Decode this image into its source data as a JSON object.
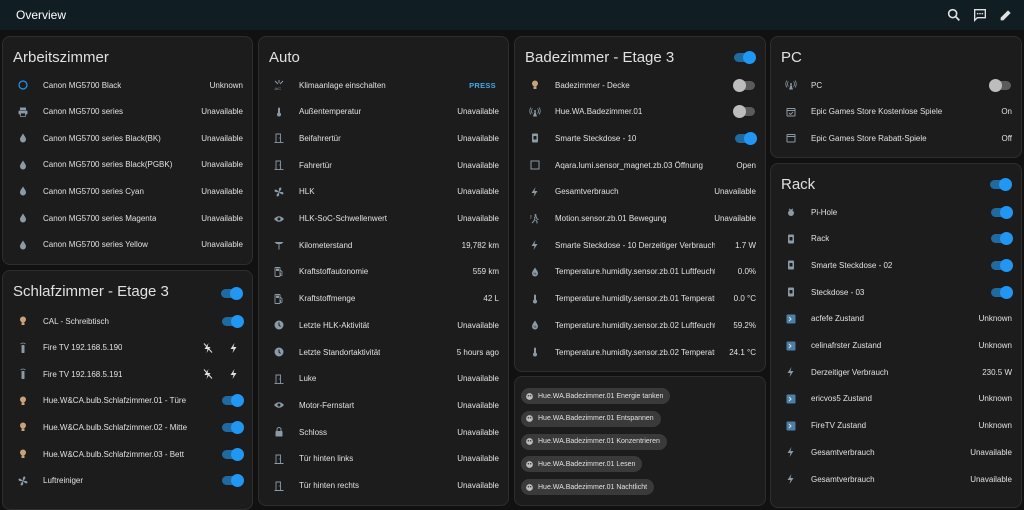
{
  "header": {
    "title": "Overview",
    "icons": [
      "search-icon",
      "chat-icon",
      "pencil-icon"
    ]
  },
  "colors": {
    "accent": "#2196f3",
    "background": "#111111",
    "card": "#1c1c1c",
    "topbar": "#101e24",
    "icon_gray": "#8a9aa6",
    "bulb": "#c8a27a"
  },
  "cards": {
    "arbeitszimmer": {
      "title": "Arbeitszimmer",
      "rows": [
        {
          "name": "Canon MG5700 Black",
          "state": "Unknown",
          "icon": "circle-outline-icon"
        },
        {
          "name": "Canon MG5700 series",
          "state": "Unavailable",
          "icon": "printer-icon"
        },
        {
          "name": "Canon MG5700 series Black(BK)",
          "state": "Unavailable",
          "icon": "water-drop-icon"
        },
        {
          "name": "Canon MG5700 series Black(PGBK)",
          "state": "Unavailable",
          "icon": "water-drop-icon"
        },
        {
          "name": "Canon MG5700 series Cyan",
          "state": "Unavailable",
          "icon": "water-drop-icon"
        },
        {
          "name": "Canon MG5700 series Magenta",
          "state": "Unavailable",
          "icon": "water-drop-icon"
        },
        {
          "name": "Canon MG5700 series Yellow",
          "state": "Unavailable",
          "icon": "water-drop-icon"
        }
      ]
    },
    "schlafzimmer": {
      "title": "Schlafzimmer - Etage 3",
      "header_toggle": "on",
      "rows": [
        {
          "name": "CAL - Schreibtisch",
          "toggle": "on",
          "icon": "bulb-icon"
        },
        {
          "name": "Fire TV 192.168.5.190",
          "buttons": [
            "flash-off-icon",
            "flash-icon"
          ],
          "icon": "remote-icon"
        },
        {
          "name": "Fire TV 192.168.5.191",
          "buttons": [
            "flash-off-icon",
            "flash-icon"
          ],
          "icon": "remote-icon"
        },
        {
          "name": "Hue.W&CA.bulb.Schlafzimmer.01 - Türe",
          "toggle": "on",
          "icon": "bulb-icon"
        },
        {
          "name": "Hue.W&CA.bulb.Schlafzimmer.02 - Mitte",
          "toggle": "on",
          "icon": "bulb-icon"
        },
        {
          "name": "Hue.W&CA.bulb.Schlafzimmer.03 - Bett",
          "toggle": "on",
          "icon": "bulb-icon"
        },
        {
          "name": "Luftreiniger",
          "toggle": "on",
          "icon": "fan-icon"
        }
      ]
    },
    "auto": {
      "title": "Auto",
      "rows": [
        {
          "name": "Klimaanlage einschalten",
          "press": "PRESS",
          "icon": "ac-icon"
        },
        {
          "name": "Außentemperatur",
          "state": "Unavailable",
          "icon": "thermometer-icon"
        },
        {
          "name": "Beifahrertür",
          "state": "Unavailable",
          "icon": "door-icon"
        },
        {
          "name": "Fahrertür",
          "state": "Unavailable",
          "icon": "door-icon"
        },
        {
          "name": "HLK",
          "state": "Unavailable",
          "icon": "fan-icon"
        },
        {
          "name": "HLK-SoC-Schwellenwert",
          "state": "Unavailable",
          "icon": "eye-icon"
        },
        {
          "name": "Kilometerstand",
          "state": "19,782 km",
          "icon": "road-icon"
        },
        {
          "name": "Kraftstoffautonomie",
          "state": "559 km",
          "icon": "fuel-icon"
        },
        {
          "name": "Kraftstoffmenge",
          "state": "42 L",
          "icon": "fuel-icon"
        },
        {
          "name": "Letzte HLK-Aktivität",
          "state": "Unavailable",
          "icon": "clock-icon"
        },
        {
          "name": "Letzte Standortaktivität",
          "state": "5 hours ago",
          "icon": "clock-icon"
        },
        {
          "name": "Luke",
          "state": "Unavailable",
          "icon": "door-icon"
        },
        {
          "name": "Motor-Fernstart",
          "state": "Unavailable",
          "icon": "eye-icon"
        },
        {
          "name": "Schloss",
          "state": "Unavailable",
          "icon": "lock-icon"
        },
        {
          "name": "Tür hinten links",
          "state": "Unavailable",
          "icon": "door-icon"
        },
        {
          "name": "Tür hinten rechts",
          "state": "Unavailable",
          "icon": "door-icon"
        }
      ]
    },
    "badezimmer": {
      "title": "Badezimmer - Etage 3",
      "header_toggle": "on",
      "rows": [
        {
          "name": "Badezimmer - Decke",
          "toggle": "off",
          "icon": "bulb-icon"
        },
        {
          "name": "Hue.WA.Badezimmer.01",
          "toggle": "off",
          "icon": "wifi-tower-icon"
        },
        {
          "name": "Smarte Steckdose - 10",
          "toggle": "on",
          "icon": "plug-icon"
        },
        {
          "name": "Aqara.lumi.sensor_magnet.zb.03 Öffnung",
          "state": "Open",
          "icon": "window-icon"
        },
        {
          "name": "Gesamtverbrauch",
          "state": "Unavailable",
          "icon": "flash-icon"
        },
        {
          "name": "Motion.sensor.zb.01 Bewegung",
          "state": "Unavailable",
          "icon": "motion-icon"
        },
        {
          "name": "Smarte Steckdose - 10 Derzeitiger Verbrauch",
          "state": "1.7 W",
          "icon": "flash-icon"
        },
        {
          "name": "Temperature.humidity.sensor.zb.01 Luftfeuchtigkeit",
          "state": "0.0%",
          "icon": "humidity-icon"
        },
        {
          "name": "Temperature.humidity.sensor.zb.01 Temperatur",
          "state": "0.0 °C",
          "icon": "thermometer-icon"
        },
        {
          "name": "Temperature.humidity.sensor.zb.02 Luftfeuchtigke...",
          "state": "59.2%",
          "icon": "humidity-icon"
        },
        {
          "name": "Temperature.humidity.sensor.zb.02 Temperatur",
          "state": "24.1 °C",
          "icon": "thermometer-icon"
        }
      ],
      "chips": [
        "Hue.WA.Badezimmer.01 Energie tanken",
        "Hue.WA.Badezimmer.01 Entspannen",
        "Hue.WA.Badezimmer.01 Konzentrieren",
        "Hue.WA.Badezimmer.01 Lesen",
        "Hue.WA.Badezimmer.01 Nachtlicht"
      ]
    },
    "pc": {
      "title": "PC",
      "rows": [
        {
          "name": "PC",
          "toggle": "off",
          "icon": "wifi-tower-icon"
        },
        {
          "name": "Epic Games Store Kostenlose Spiele",
          "state": "On",
          "icon": "calendar-check-icon"
        },
        {
          "name": "Epic Games Store Rabatt-Spiele",
          "state": "Off",
          "icon": "calendar-icon"
        }
      ]
    },
    "rack": {
      "title": "Rack",
      "header_toggle": "on",
      "rows": [
        {
          "name": "Pi-Hole",
          "toggle": "on",
          "icon": "raspberry-icon"
        },
        {
          "name": "Rack",
          "toggle": "on",
          "icon": "plug-icon"
        },
        {
          "name": "Smarte Steckdose - 02",
          "toggle": "on",
          "icon": "plug-icon"
        },
        {
          "name": "Steckdose - 03",
          "toggle": "on",
          "icon": "plug-icon"
        },
        {
          "name": "acfefe Zustand",
          "state": "Unknown",
          "icon": "console-icon"
        },
        {
          "name": "celinafrster Zustand",
          "state": "Unknown",
          "icon": "console-icon"
        },
        {
          "name": "Derzeitiger Verbrauch",
          "state": "230.5 W",
          "icon": "flash-icon"
        },
        {
          "name": "ericvos5 Zustand",
          "state": "Unknown",
          "icon": "console-icon"
        },
        {
          "name": "FireTV Zustand",
          "state": "Unknown",
          "icon": "console-icon"
        },
        {
          "name": "Gesamtverbrauch",
          "state": "Unavailable",
          "icon": "flash-icon"
        },
        {
          "name": "Gesamtverbrauch",
          "state": "Unavailable",
          "icon": "flash-icon"
        }
      ]
    }
  }
}
